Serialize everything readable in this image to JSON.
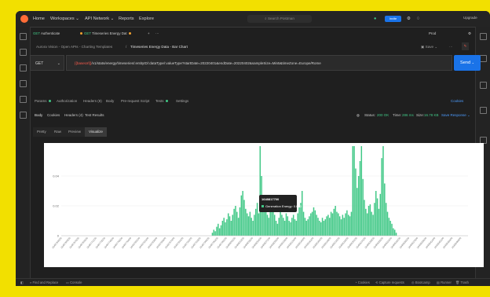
{
  "titlebar": {
    "home": "Home",
    "workspaces": "Workspaces",
    "api_network": "API Network",
    "reports": "Reports",
    "explore": "Explore",
    "search_placeholder": "Search Postman",
    "invite": "Invite",
    "upgrade": "Upgrade"
  },
  "tabs": [
    {
      "label": "Authenticate"
    },
    {
      "label": "Timeseries Energy Dat"
    }
  ],
  "environment": "Prod",
  "breadcrumb": {
    "path": "Aurora Vision - Open APIs - Charting Templates",
    "separator": "/",
    "current": "Timeseries Energy Data - Bar Chart",
    "save": "Save"
  },
  "request": {
    "method": "GET",
    "url_var": "{{baseUrl}}",
    "url_rest": "/v1/stats/energy/timeseries/:entityID/:dataType/:valueType?startDate=20220401&endDate=20220402&sampleSize=Min5&timeZone=Europe/Rome",
    "send": "Send"
  },
  "request_tabs": {
    "params": "Params",
    "authorization": "Authorization",
    "headers": "Headers (8)",
    "body": "Body",
    "prerequest": "Pre-request Script",
    "tests": "Tests",
    "settings": "Settings",
    "cookies": "Cookies"
  },
  "response": {
    "body": "Body",
    "cookies": "Cookies",
    "headers": "Headers (4)",
    "test_results": "Test Results",
    "status_label": "Status:",
    "status": "200 OK",
    "time_label": "Time:",
    "time": "286 ms",
    "size_label": "Size:",
    "size": "16.78 KB",
    "save_response": "Save Response"
  },
  "view_tabs": {
    "pretty": "Pretty",
    "raw": "Raw",
    "preview": "Preview",
    "visualize": "Visualize"
  },
  "tooltip": {
    "title": "1648817700",
    "series": "Generation Energy",
    "value": "0.010"
  },
  "statusbar": {
    "find": "Find and Replace",
    "console": "Console",
    "cookies": "Cookies",
    "capture": "Capture requests",
    "bootcamp": "Bootcamp",
    "runner": "Runner",
    "trash": "Trash"
  },
  "colors": {
    "bar": "#40c886",
    "accent": "#ff6c37",
    "send": "#1a73e8"
  },
  "chart_data": {
    "type": "bar",
    "series": [
      {
        "name": "Generation Energy",
        "values": [
          0,
          0,
          0,
          0,
          0,
          0,
          0,
          0,
          0,
          0,
          0,
          0,
          0,
          0,
          0,
          0,
          0,
          0,
          0,
          0,
          0,
          0,
          0,
          0,
          0,
          0,
          0,
          0,
          0,
          0,
          0,
          0,
          0,
          0,
          0,
          0,
          0,
          0,
          0,
          0,
          0,
          0,
          0,
          0,
          0,
          0,
          0,
          0,
          0,
          0,
          0,
          0,
          0,
          0,
          0,
          0,
          0,
          0,
          0,
          0,
          0,
          0,
          0,
          0,
          0,
          0,
          0,
          0,
          0,
          0,
          0,
          0,
          0,
          0,
          0,
          0,
          0,
          0,
          0,
          0,
          0,
          0,
          0,
          0,
          0,
          0,
          0,
          0,
          0,
          0,
          0,
          0,
          0,
          0,
          0,
          0,
          0,
          0,
          0,
          0,
          0,
          0,
          0,
          0,
          0.002,
          0.004,
          0.003,
          0.006,
          0.008,
          0.005,
          0.007,
          0.01,
          0.012,
          0.009,
          0.011,
          0.015,
          0.013,
          0.01,
          0.014,
          0.018,
          0.02,
          0.016,
          0.012,
          0.019,
          0.027,
          0.03,
          0.024,
          0.018,
          0.015,
          0.013,
          0.016,
          0.012,
          0.01,
          0.014,
          0.018,
          0.022,
          0.015,
          0.06,
          0.04,
          0.025,
          0.016,
          0.02,
          0.014,
          0.012,
          0.018,
          0.023,
          0.019,
          0.014,
          0.01,
          0.008,
          0.012,
          0.016,
          0.014,
          0.012,
          0.01,
          0.015,
          0.013,
          0.01,
          0.009,
          0.012,
          0.014,
          0.011,
          0.01,
          0.015,
          0.019,
          0.022,
          0.03,
          0.016,
          0.012,
          0.01,
          0.011,
          0.013,
          0.015,
          0.016,
          0.019,
          0.017,
          0.014,
          0.012,
          0.01,
          0.009,
          0.012,
          0.01,
          0.011,
          0.013,
          0.014,
          0.012,
          0.016,
          0.015,
          0.018,
          0.02,
          0.016,
          0.015,
          0.013,
          0.011,
          0.014,
          0.012,
          0.015,
          0.017,
          0.014,
          0.013,
          0.016,
          0.06,
          0.06,
          0.045,
          0.032,
          0.04,
          0.05,
          0.06,
          0.038,
          0.024,
          0.018,
          0.015,
          0.02,
          0.021,
          0.016,
          0.014,
          0.022,
          0.03,
          0.025,
          0.018,
          0.028,
          0.052,
          0.06,
          0.035,
          0.022,
          0.016,
          0.012,
          0.01,
          0.008,
          0.005,
          0.004,
          0.002,
          0,
          0,
          0,
          0,
          0,
          0,
          0,
          0,
          0,
          0,
          0,
          0,
          0,
          0,
          0,
          0,
          0,
          0,
          0,
          0,
          0,
          0,
          0,
          0,
          0,
          0,
          0,
          0,
          0,
          0,
          0,
          0,
          0,
          0,
          0,
          0,
          0,
          0,
          0,
          0,
          0,
          0,
          0,
          0,
          0,
          0,
          0,
          0,
          0
        ]
      }
    ],
    "y_ticks": [
      "0",
      "0.02",
      "0.04"
    ],
    "ylim": [
      0,
      0.06
    ],
    "x_first": 1648764000,
    "x_step": 300,
    "x_tick_labels_every": 6,
    "grid": true
  }
}
